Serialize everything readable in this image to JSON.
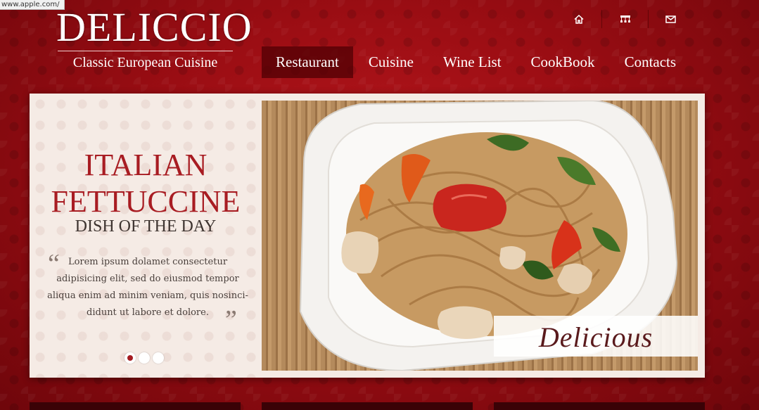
{
  "browser": {
    "status_url": "www.apple.com/"
  },
  "logo": {
    "title": "DELICCIO",
    "subtitle": "Classic European Cuisine"
  },
  "top_icons": [
    {
      "name": "home-icon"
    },
    {
      "name": "sitemap-icon"
    },
    {
      "name": "mail-icon"
    }
  ],
  "nav": [
    {
      "label": "Restaurant",
      "active": true
    },
    {
      "label": "Cuisine",
      "active": false
    },
    {
      "label": "Wine List",
      "active": false
    },
    {
      "label": "CookBook",
      "active": false
    },
    {
      "label": "Contacts",
      "active": false
    }
  ],
  "slide": {
    "title_line1": "ITALIAN",
    "title_line2": "FETTUCCINE",
    "subtitle": "DISH OF THE DAY",
    "quote_open": "“",
    "quote_close": "”",
    "description": "Lorem ipsum dolamet consectetur adipisicing elit, sed do eiusmod tempor aliqua enim ad minim veniam, quis nosinci-didunt ut labore et dolore.",
    "caption": "Delicious",
    "dots": [
      {
        "active": true
      },
      {
        "active": false
      },
      {
        "active": false
      }
    ]
  },
  "colors": {
    "background": "#9a0d13",
    "accent": "#a81c22",
    "panel": "#f5ebe5"
  }
}
